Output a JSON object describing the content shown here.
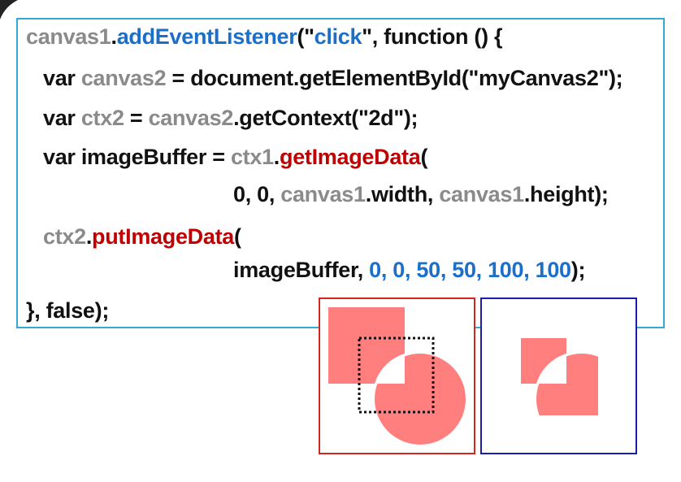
{
  "code": {
    "lines": [
      [
        {
          "t": "canvas1",
          "c": "g"
        },
        {
          "t": ".",
          "c": "k"
        },
        {
          "t": "addEventListener",
          "c": "b"
        },
        {
          "t": "(\"",
          "c": "k"
        },
        {
          "t": "click",
          "c": "b"
        },
        {
          "t": "\", function () {",
          "c": "k"
        }
      ],
      [
        {
          "t": "var ",
          "c": "k"
        },
        {
          "t": "canvas2",
          "c": "g"
        },
        {
          "t": " = document.getElementById(\"myCanvas2\");",
          "c": "k"
        }
      ],
      [
        {
          "t": "var ",
          "c": "k"
        },
        {
          "t": "ctx2",
          "c": "g"
        },
        {
          "t": " = ",
          "c": "k"
        },
        {
          "t": "canvas2",
          "c": "g"
        },
        {
          "t": ".getContext(\"2d\");",
          "c": "k"
        }
      ],
      [
        {
          "t": "var imageBuffer = ",
          "c": "k"
        },
        {
          "t": "ctx1",
          "c": "g"
        },
        {
          "t": ".",
          "c": "k"
        },
        {
          "t": "getImageData",
          "c": "r"
        },
        {
          "t": "(",
          "c": "k"
        }
      ],
      [
        {
          "t": "0, 0, ",
          "c": "k"
        },
        {
          "t": "canvas1",
          "c": "g"
        },
        {
          "t": ".width, ",
          "c": "k"
        },
        {
          "t": "canvas1",
          "c": "g"
        },
        {
          "t": ".height);",
          "c": "k"
        }
      ],
      [
        {
          "t": "ctx2",
          "c": "g"
        },
        {
          "t": ".",
          "c": "k"
        },
        {
          "t": "putImageData",
          "c": "r"
        },
        {
          "t": "(",
          "c": "k"
        }
      ],
      [
        {
          "t": "imageBuffer, ",
          "c": "k"
        },
        {
          "t": "0, 0, 50, 50, 100, 100",
          "c": "b"
        },
        {
          "t": ");",
          "c": "k"
        }
      ],
      [
        {
          "t": "}, false);",
          "c": "k"
        }
      ]
    ]
  },
  "colors": {
    "code_border": "#34a9d6",
    "canvas1_border": "#d42424",
    "canvas2_border": "#1c1cb0",
    "shape_fill": "#ff7f7f"
  }
}
